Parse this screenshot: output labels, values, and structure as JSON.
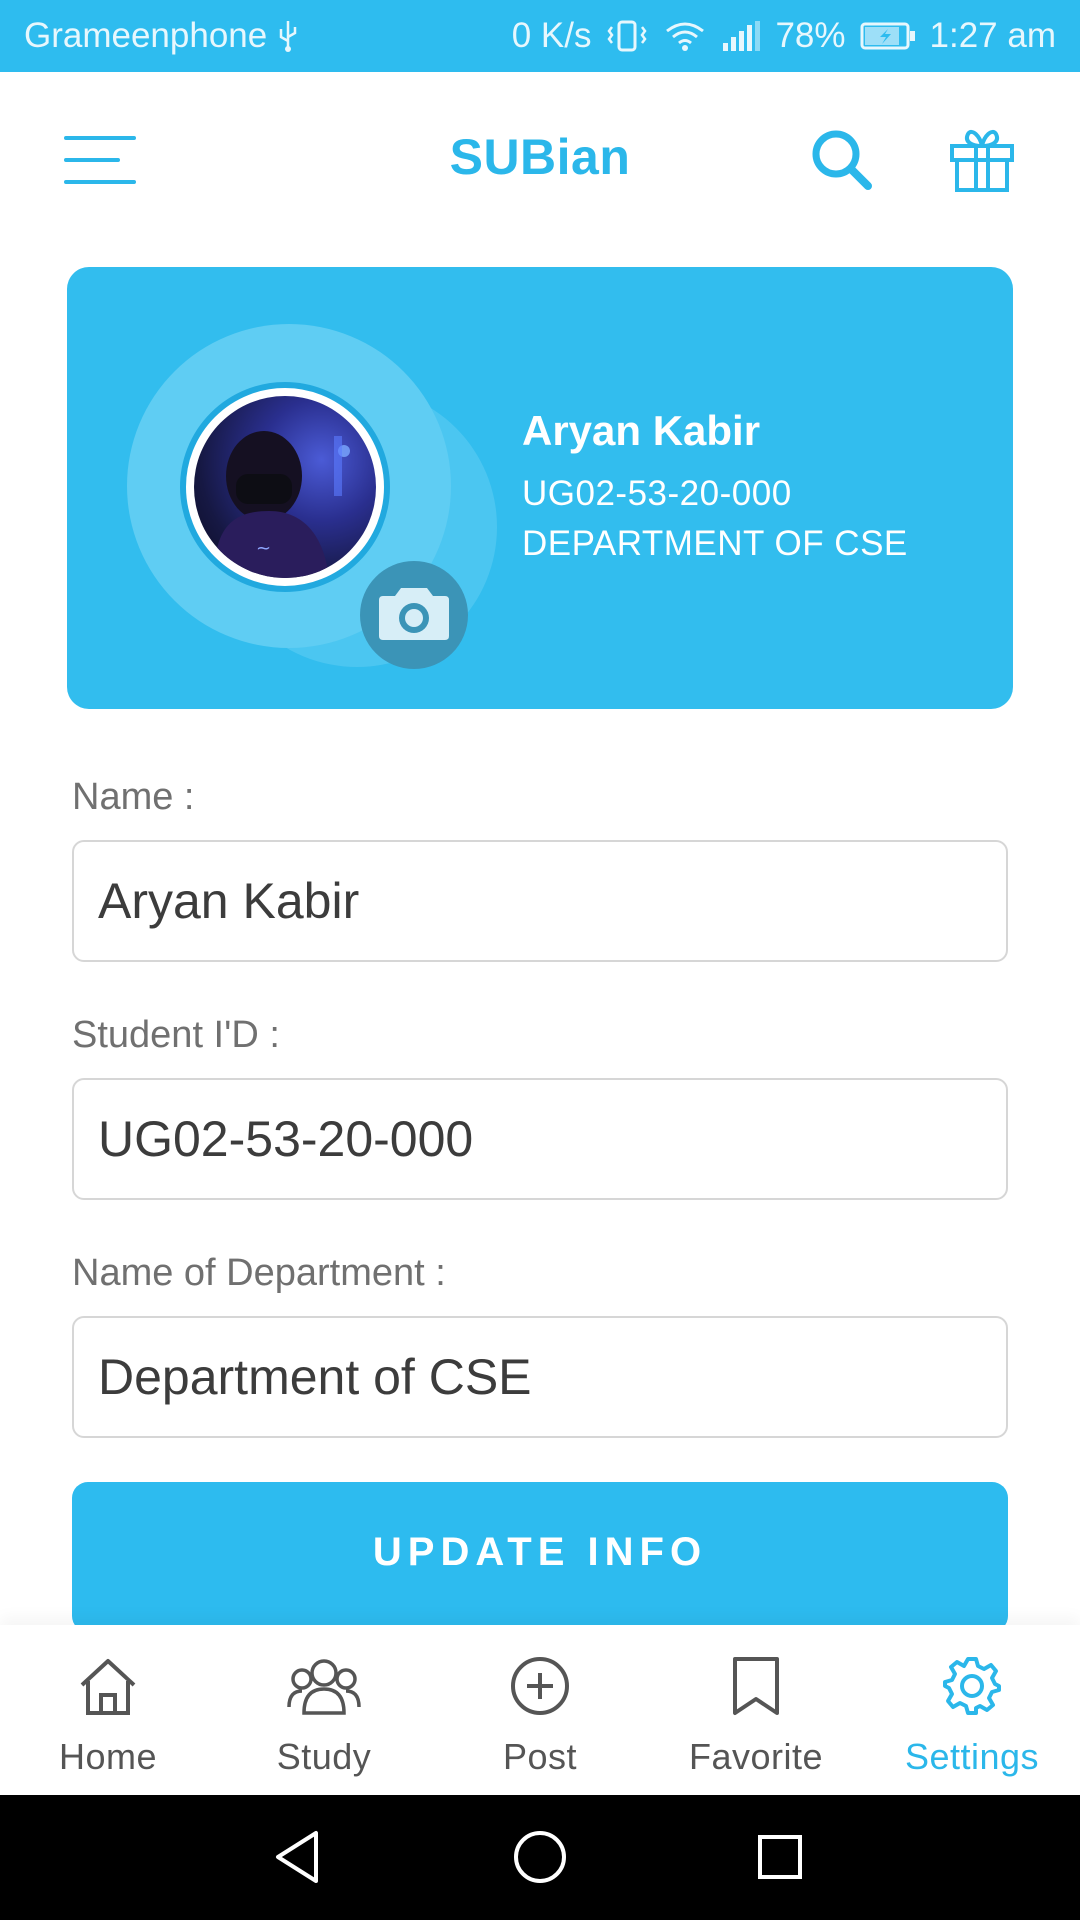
{
  "status_bar": {
    "carrier": "Grameenphone",
    "speed": "0 K/s",
    "battery": "78%",
    "time": "1:27 am"
  },
  "header": {
    "title": "SUBian"
  },
  "profile_card": {
    "name": "Aryan Kabir",
    "student_id": "UG02-53-20-000",
    "department": "DEPARTMENT OF CSE"
  },
  "form": {
    "name_label": "Name :",
    "name_value": "Aryan Kabir",
    "id_label": "Student I'D :",
    "id_value": "UG02-53-20-000",
    "dept_label": "Name of Department :",
    "dept_value": "Department of CSE",
    "submit_label": "UPDATE INFO"
  },
  "bottom_nav": {
    "items": [
      {
        "label": "Home",
        "icon": "home-icon"
      },
      {
        "label": "Study",
        "icon": "group-icon"
      },
      {
        "label": "Post",
        "icon": "plus-circle-icon"
      },
      {
        "label": "Favorite",
        "icon": "bookmark-icon"
      },
      {
        "label": "Settings",
        "icon": "gear-icon"
      }
    ],
    "active": "Settings"
  },
  "colors": {
    "accent": "#2dbbef",
    "camera_button": "#3b94b7",
    "text_muted": "#707070"
  }
}
